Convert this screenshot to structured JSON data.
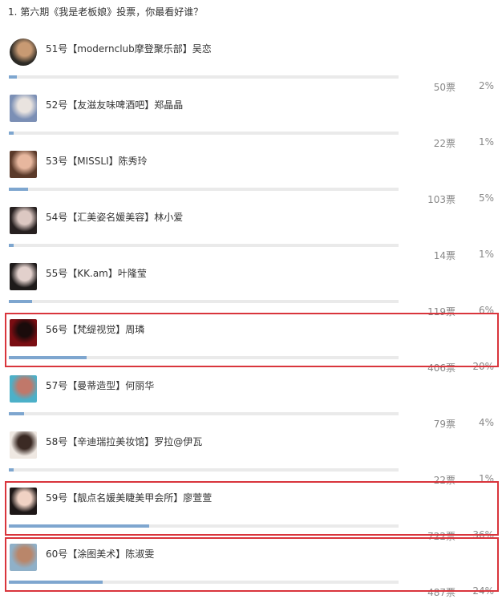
{
  "poll": {
    "title": "1. 第六期《我是老板娘》投票，你最看好谁？"
  },
  "options": [
    {
      "label": "51号【modernclub摩登聚乐部】吴恋",
      "votes": "50票",
      "pct": "2%",
      "share": 0.02,
      "highlighted": false,
      "avatar_colors": [
        "#2c2a25",
        "#c89a73"
      ]
    },
    {
      "label": "52号【友滋友味啤酒吧】郑晶晶",
      "votes": "22票",
      "pct": "1%",
      "share": 0.01,
      "highlighted": false,
      "avatar_colors": [
        "#7b8fb5",
        "#e9e3df"
      ]
    },
    {
      "label": "53号【MISSLI】陈秀玲",
      "votes": "103票",
      "pct": "5%",
      "share": 0.05,
      "highlighted": false,
      "avatar_colors": [
        "#5b3a2a",
        "#e7b79e"
      ]
    },
    {
      "label": "54号【汇美姿名媛美容】林小爱",
      "votes": "14票",
      "pct": "1%",
      "share": 0.01,
      "highlighted": false,
      "avatar_colors": [
        "#272020",
        "#dcc8c2"
      ]
    },
    {
      "label": "55号【KK.am】叶隆莹",
      "votes": "119票",
      "pct": "6%",
      "share": 0.06,
      "highlighted": false,
      "avatar_colors": [
        "#1e1a1a",
        "#e2d0cc"
      ]
    },
    {
      "label": "56号【梵缇视觉】周璘",
      "votes": "406票",
      "pct": "20%",
      "share": 0.2,
      "highlighted": true,
      "avatar_colors": [
        "#7a0d12",
        "#1a0b0b"
      ]
    },
    {
      "label": "57号【曼蒂造型】何丽华",
      "votes": "79票",
      "pct": "4%",
      "share": 0.04,
      "highlighted": false,
      "avatar_colors": [
        "#4cb0c8",
        "#c0786a"
      ]
    },
    {
      "label": "58号【辛迪瑞拉美妆馆】罗拉@伊瓦",
      "votes": "22票",
      "pct": "1%",
      "share": 0.01,
      "highlighted": false,
      "avatar_colors": [
        "#efe8e2",
        "#3b2a24"
      ]
    },
    {
      "label": "59号【靓点名媛美睫美甲会所】廖萱萱",
      "votes": "722票",
      "pct": "36%",
      "share": 0.36,
      "highlighted": true,
      "avatar_colors": [
        "#1d1717",
        "#f0d2c4"
      ]
    },
    {
      "label": "60号【涂图美术】陈淑雯",
      "votes": "487票",
      "pct": "24%",
      "share": 0.24,
      "highlighted": true,
      "avatar_colors": [
        "#8fb0c8",
        "#b9866a"
      ]
    }
  ],
  "colors": {
    "bar_fill": "#7ea6cf",
    "bar_track": "#eaeaea",
    "highlight_border": "#d9353c",
    "muted_text": "#888888"
  }
}
